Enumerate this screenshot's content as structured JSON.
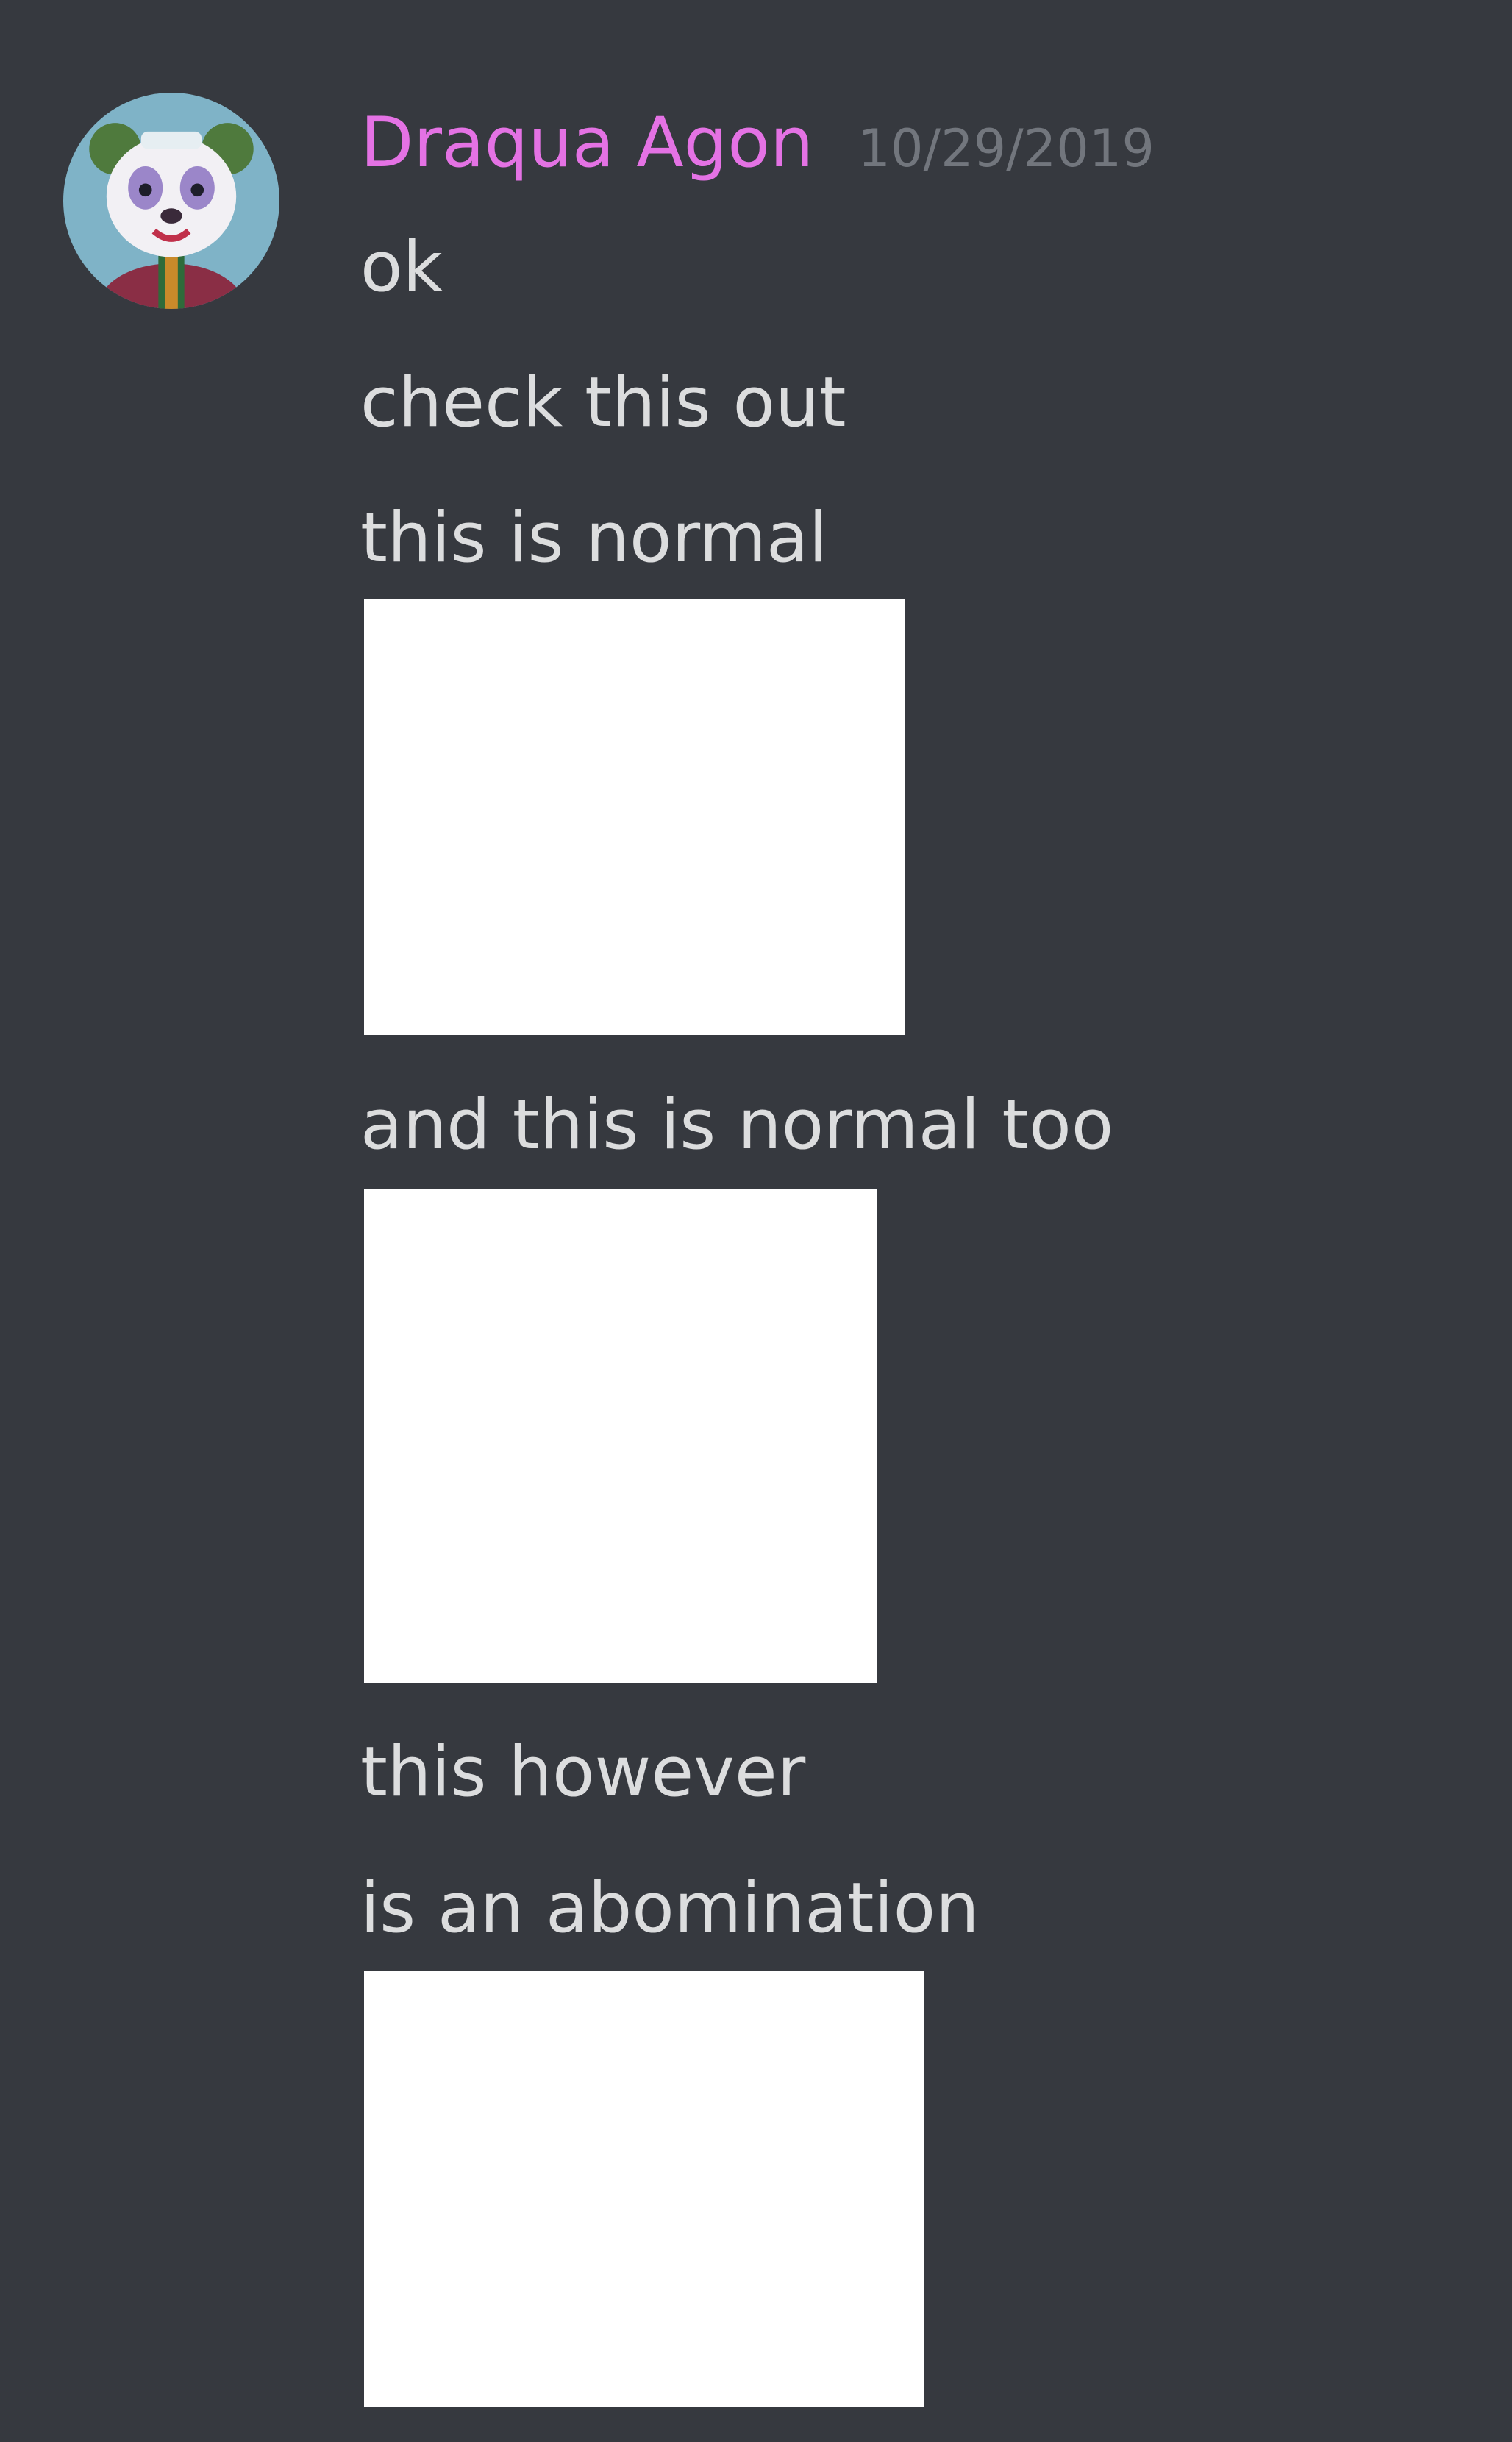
{
  "message": {
    "author": {
      "name": "Draqua Agon",
      "name_color": "#e472e4",
      "avatar_icon": "panda-clown-avatar"
    },
    "timestamp": "10/29/2019",
    "lines": [
      "ok",
      "check this out",
      "this is normal",
      "and this is normal too",
      "this however",
      "is an abomination"
    ],
    "attachments": [
      {
        "type": "image",
        "color": "#ffffff"
      },
      {
        "type": "image",
        "color": "#ffffff"
      },
      {
        "type": "image",
        "color": "#ffffff"
      }
    ]
  },
  "theme": {
    "background": "#36393f",
    "text": "#dcddde",
    "muted": "#72767d"
  }
}
